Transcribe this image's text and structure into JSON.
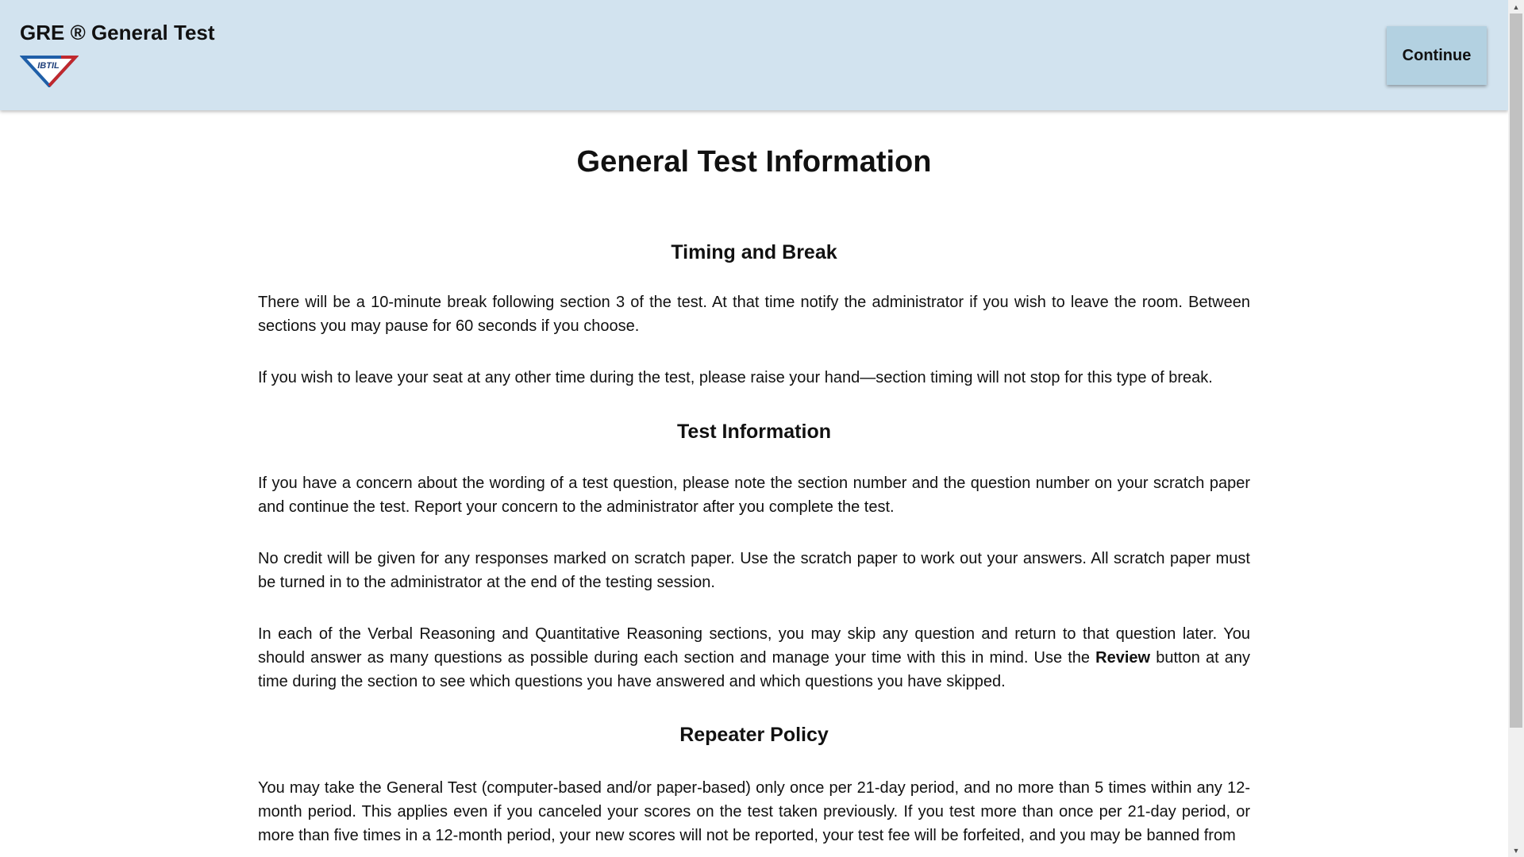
{
  "header": {
    "app_title": "GRE ® General Test",
    "logo_text": "IBTIL",
    "continue_label": "Continue"
  },
  "main": {
    "title": "General Test Information",
    "sections": {
      "timing": {
        "heading": "Timing and Break",
        "p1": "There will be a 10-minute break following section 3 of the test. At that time notify the administrator if you wish to leave the room. Between sections you may pause for 60 seconds if you choose.",
        "p2": "If you wish to leave your seat at any other time during the test, please raise your hand—section timing will not stop for this type of break."
      },
      "test_info": {
        "heading": "Test Information",
        "p1": "If you have a concern about the wording of a test question, please note the section number and the question number on your scratch paper and continue the test. Report your concern to the administrator after you complete the test.",
        "p2": "No credit will be given for any responses marked on scratch paper. Use the scratch paper to work out your answers. All scratch paper must be turned in to the administrator at the end of the testing session.",
        "p3_before": "In each of the Verbal Reasoning and Quantitative Reasoning sections, you may skip any question and return to that question later. You should answer as many questions as possible during each section and manage your time with this in mind. Use the ",
        "p3_bold": "Review",
        "p3_after": " button at any time during the section to see which questions you have answered and which questions you have skipped."
      },
      "repeater": {
        "heading": "Repeater Policy",
        "p1": "You may take the General Test (computer-based and/or paper-based) only once per 21-day period, and no more than 5 times within any 12-month period. This applies even if you canceled your scores on the test taken previously. If you test more than once per 21-day period, or more than five times in a 12-month period, your new scores will not be reported, your test fee will be forfeited, and you may be banned from"
      }
    }
  },
  "scrollbar": {
    "up_icon": "▲",
    "down_icon": "▼"
  },
  "colors": {
    "header_bg": "#d2e3ef",
    "button_bg": "#b3d1e1",
    "logo_blue": "#1f5fa8",
    "logo_red": "#c0282d"
  }
}
